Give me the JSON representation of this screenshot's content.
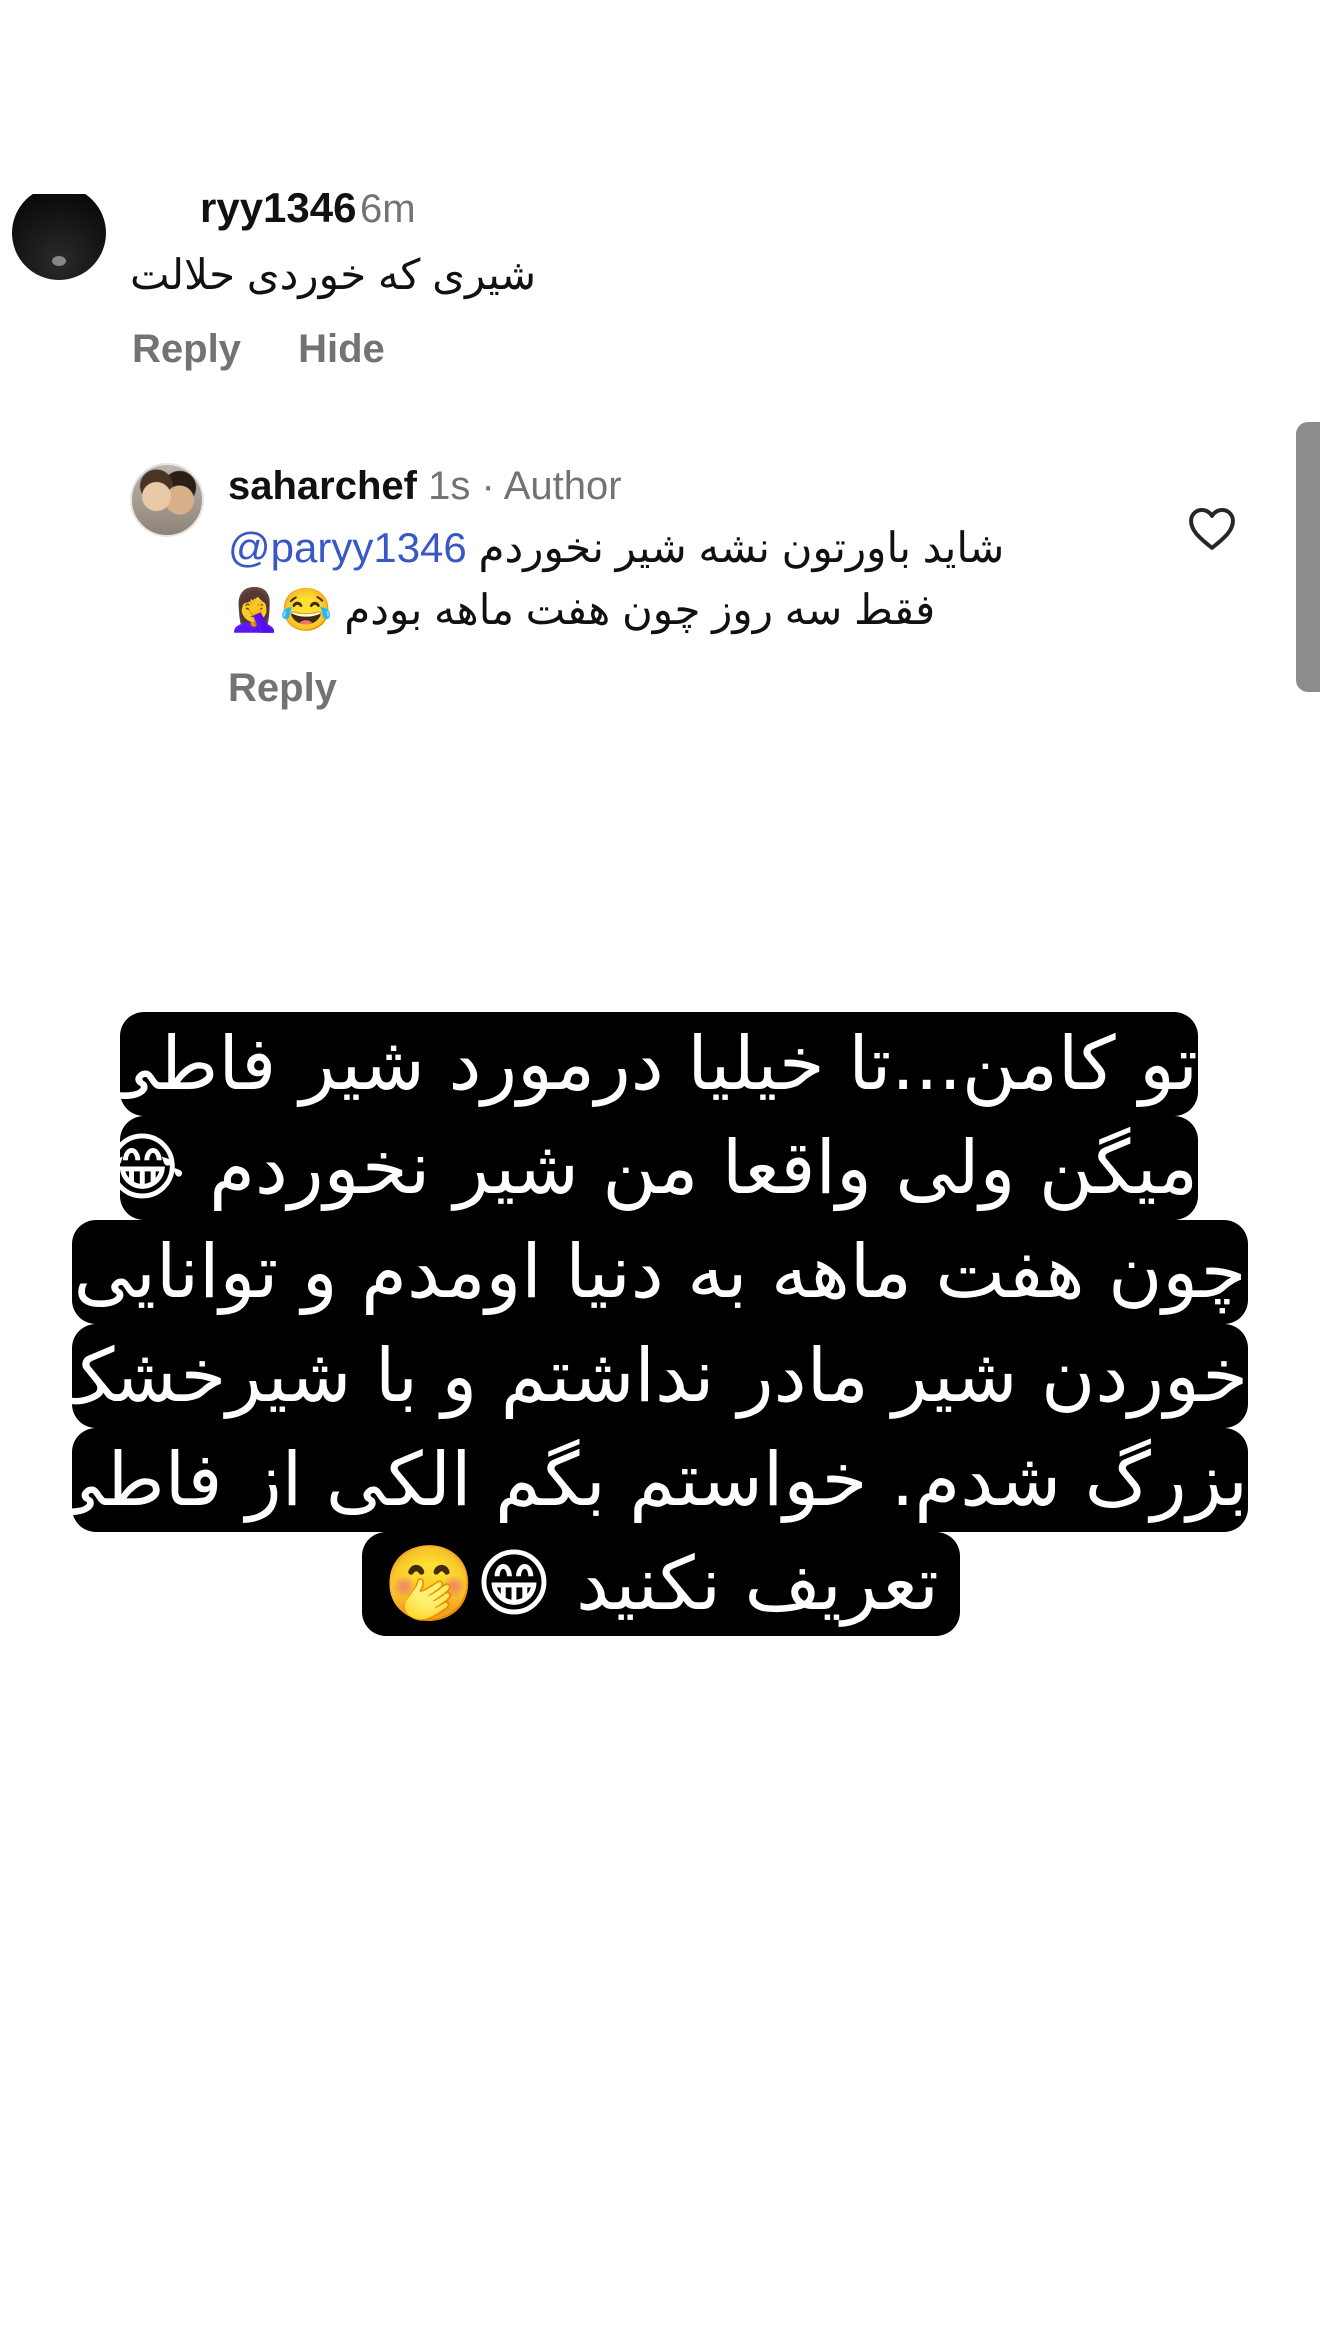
{
  "comment": {
    "username": "ryy1346",
    "username_visible": "۳ر ۳46",
    "time": "6m",
    "text": "شیری که خوردی حلالت",
    "actions": [
      "Reply",
      "Hide"
    ]
  },
  "reply": {
    "username": "saharchef",
    "time": "1s",
    "separator": "·",
    "badge": "Author",
    "mention": "@paryy1346",
    "line1_text": "شاید باورتون نشه شیر نخوردم",
    "line2_text": "فقط سه روز چون هفت ماهه بودم 😂🤦‍♀️",
    "action": "Reply",
    "like_icon": "heart-outline-icon"
  },
  "caption": {
    "lines": [
      "تو کامن...تا خیلیا درمورد شیر فاطی",
      "میگن ولی واقعا من شیر نخوردم 😂",
      "چون هفت ماهه به دنیا اومدم و توانایی",
      "خوردن شیر مادر نداشتم و با شیرخشک",
      "بزرگ شدم. خواستم بگم الکی از فاطی",
      "تعریف نکنید 😁🤭"
    ]
  },
  "colors": {
    "mention": "#3a57c6",
    "muted": "#737373",
    "caption_bg": "#000000",
    "caption_text": "#ffffff"
  }
}
